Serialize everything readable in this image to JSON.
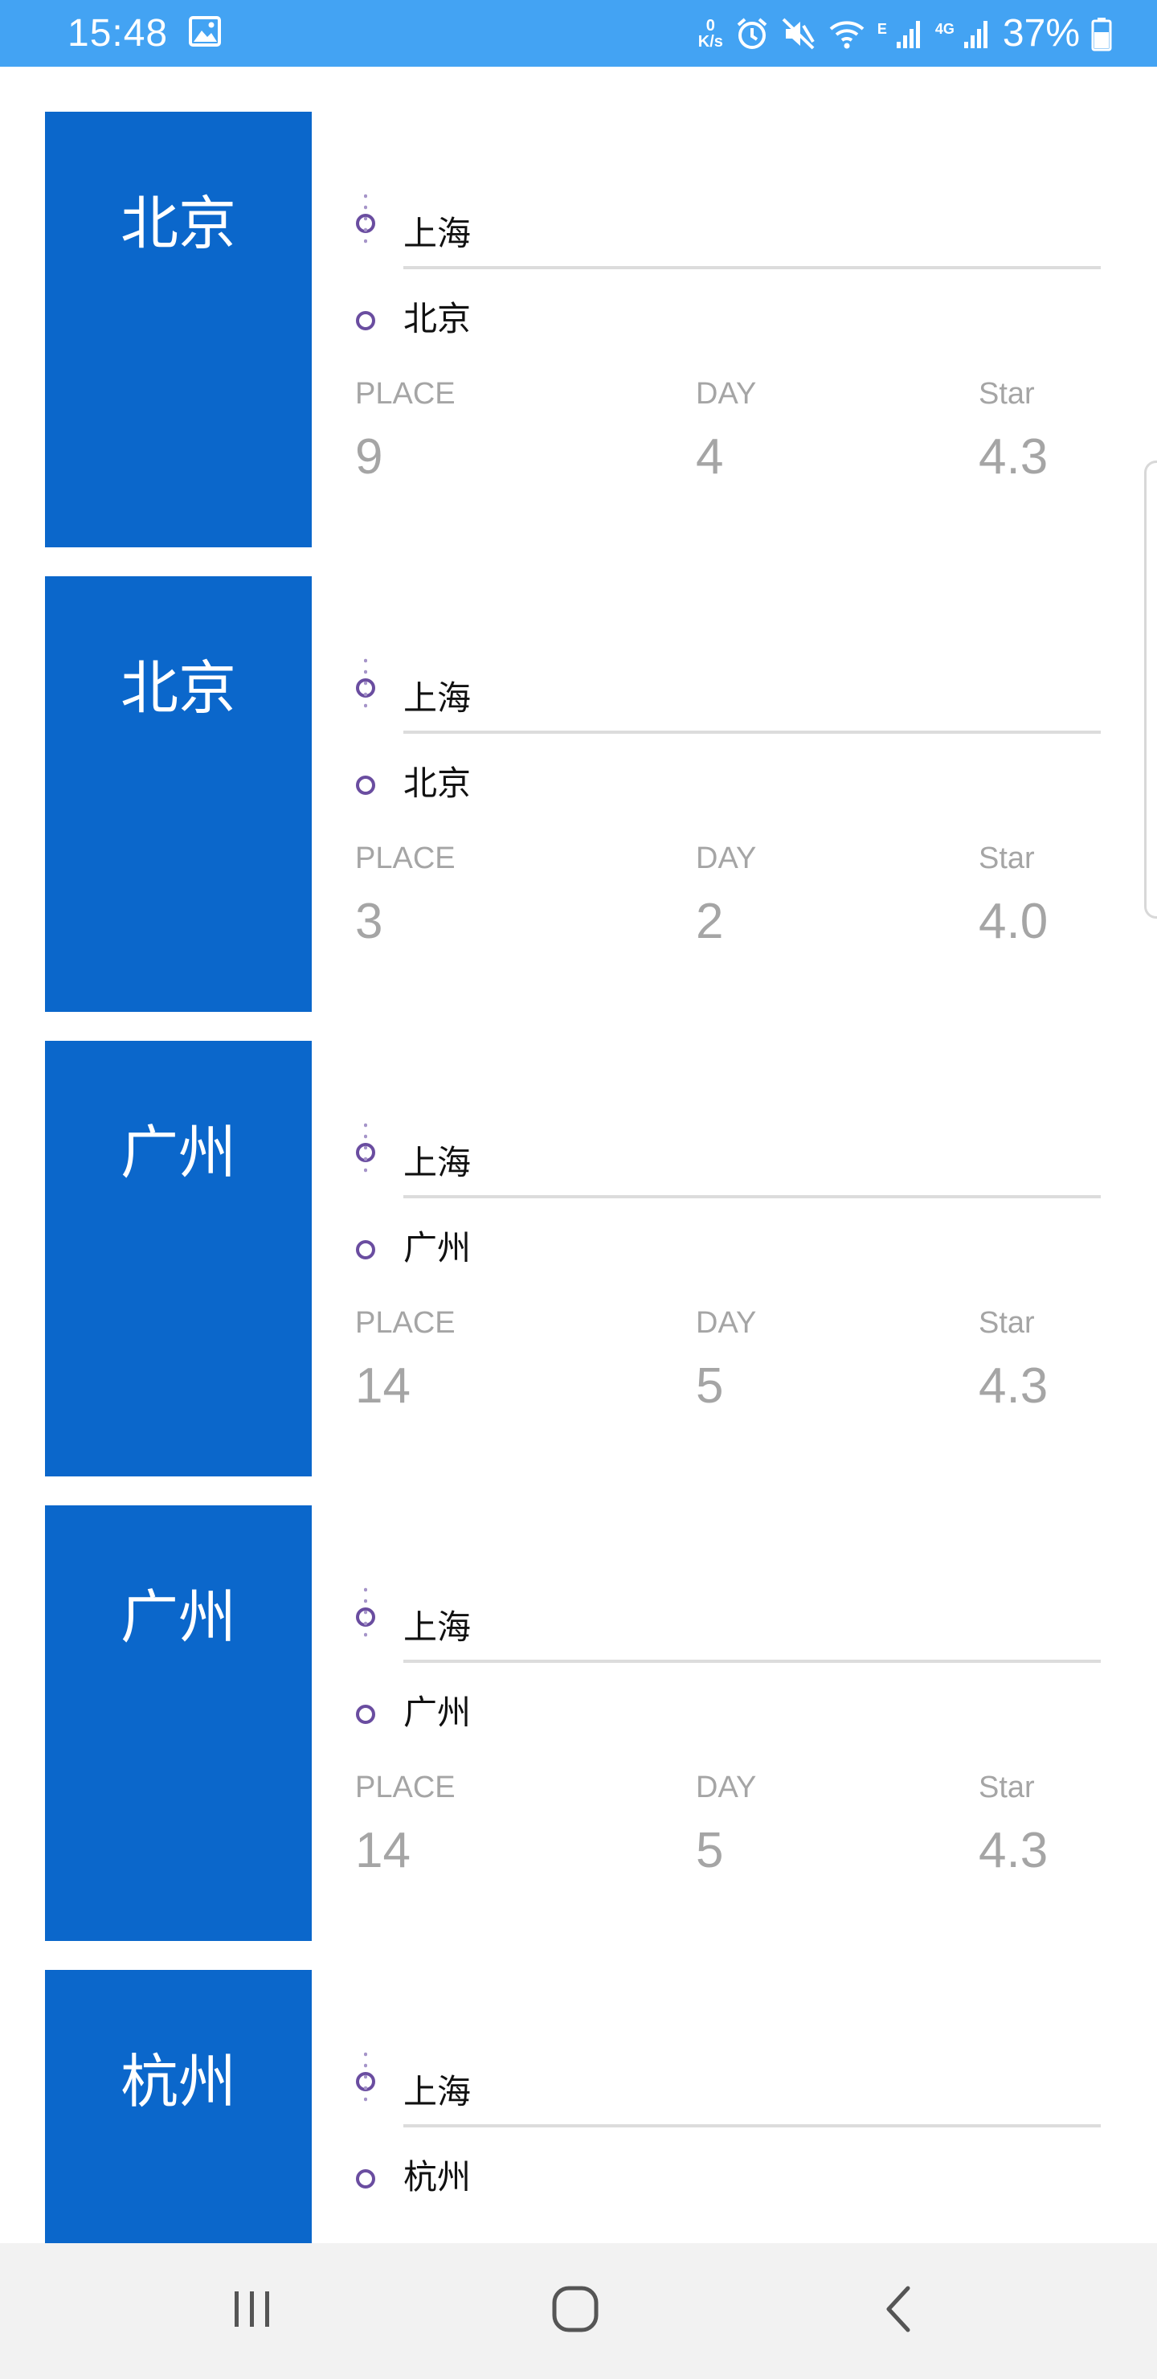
{
  "status_bar": {
    "time": "15:48",
    "netspeed_value": "0",
    "netspeed_unit": "K/s",
    "signal_1_tag": "E",
    "signal_2_tag": "4G",
    "battery": "37%"
  },
  "labels": {
    "place": "PLACE",
    "day": "DAY",
    "star": "Star"
  },
  "trips": [
    {
      "city": "北京",
      "from": "上海",
      "to": "北京",
      "place": "9",
      "day": "4",
      "star": "4.3"
    },
    {
      "city": "北京",
      "from": "上海",
      "to": "北京",
      "place": "3",
      "day": "2",
      "star": "4.0"
    },
    {
      "city": "广州",
      "from": "上海",
      "to": "广州",
      "place": "14",
      "day": "5",
      "star": "4.3"
    },
    {
      "city": "广州",
      "from": "上海",
      "to": "广州",
      "place": "14",
      "day": "5",
      "star": "4.3"
    },
    {
      "city": "杭州",
      "from": "上海",
      "to": "杭州",
      "place": "",
      "day": "",
      "star": ""
    }
  ],
  "colors": {
    "status_bar": "#43a3f3",
    "card_block": "#0b67cb",
    "route_dot": "#6a4da0",
    "stat_text": "#a5a5a5"
  },
  "nav": {
    "recents_icon": "recents-icon",
    "home_icon": "home-icon",
    "back_icon": "back-icon"
  }
}
